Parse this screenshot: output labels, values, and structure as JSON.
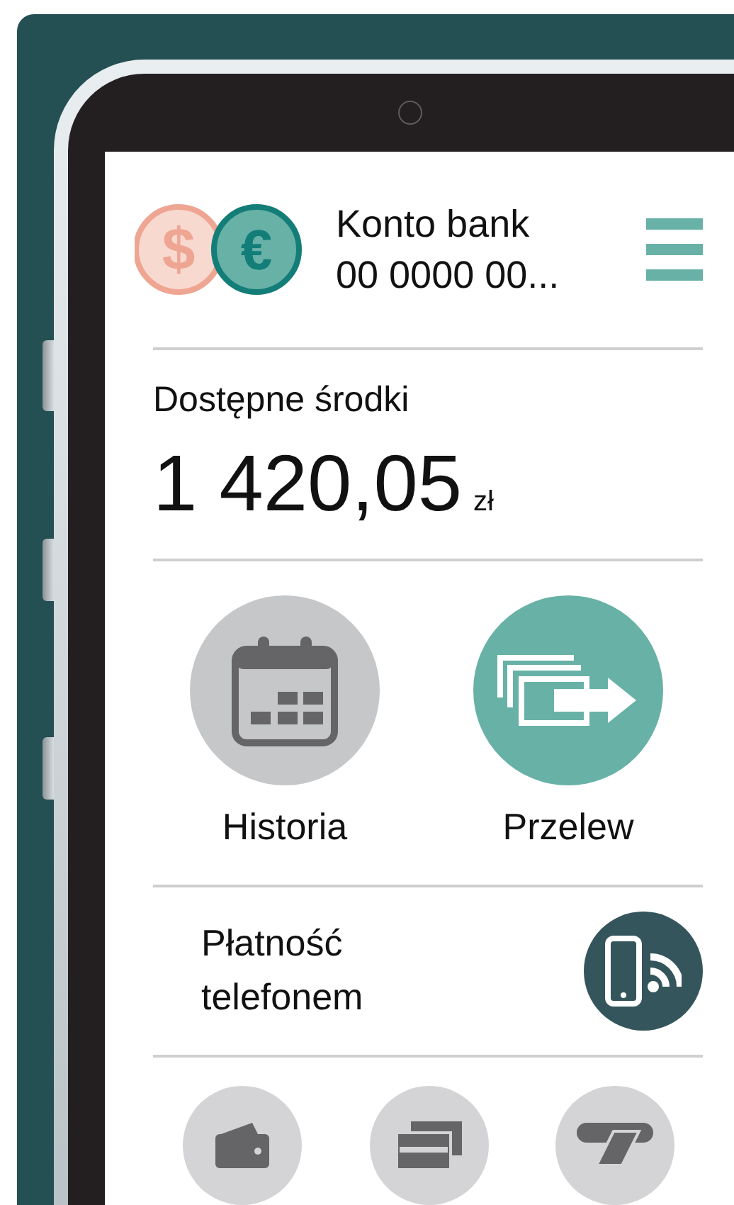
{
  "account": {
    "coins": [
      "$",
      "€"
    ],
    "title": "Konto bank",
    "number": "00 0000 00..."
  },
  "balance": {
    "label": "Dostępne środki",
    "amount": "1 420,05",
    "currency": "zł"
  },
  "actions": [
    {
      "kind": "history",
      "label": "Historia",
      "color": "#c6c7c9"
    },
    {
      "kind": "transfer",
      "label": "Przelew",
      "color": "#68b1a7"
    }
  ],
  "phone_payment": {
    "label_lines": [
      "Płatność",
      "telefonem"
    ]
  },
  "shortcuts": [
    {
      "kind": "wallet"
    },
    {
      "kind": "cards"
    },
    {
      "kind": "cash"
    }
  ]
}
